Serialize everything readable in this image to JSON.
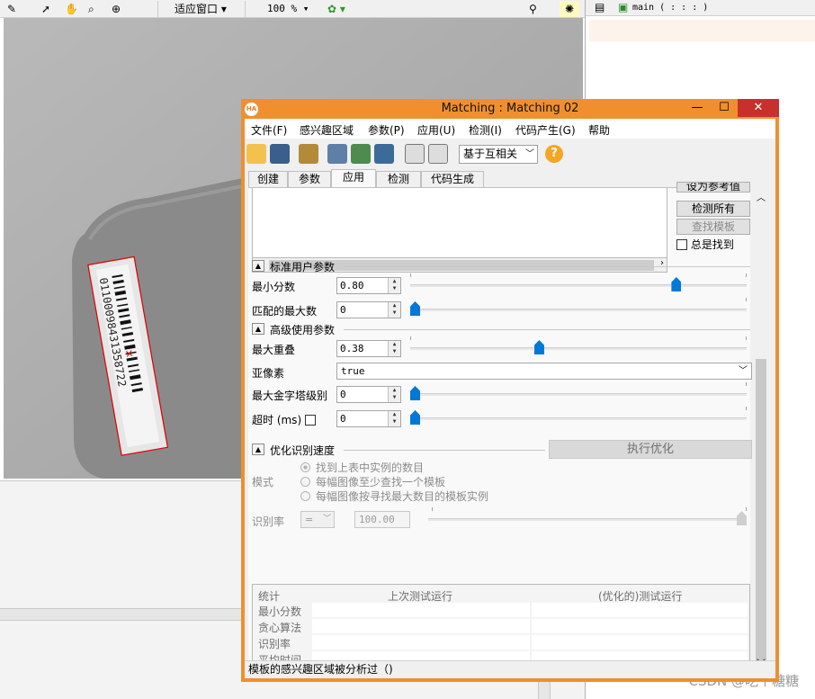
{
  "background_app": {
    "zoom_fit": "适应窗口",
    "zoom_percent": "100 %",
    "editor_tab": "main ( : : : )",
    "barcode_text": "01100098431358722"
  },
  "window": {
    "title": "Matching : Matching 02",
    "app_icon_text": "HA",
    "minimize": "—",
    "maximize": "☐",
    "close": "✕"
  },
  "menu": [
    "文件(F)",
    "感兴趣区域",
    "参数(P)",
    "应用(U)",
    "检测(I)",
    "代码产生(G)",
    "帮助"
  ],
  "toolbar": {
    "metric_combo": "基于互相关",
    "help_glyph": "?"
  },
  "tabs": [
    {
      "label": "创建",
      "active": false
    },
    {
      "label": "参数",
      "active": false
    },
    {
      "label": "应用",
      "active": true
    },
    {
      "label": "检测",
      "active": false
    },
    {
      "label": "代码生成",
      "active": false
    }
  ],
  "reference_panel": {
    "set_reference_btn": "设为参考值",
    "detect_all_btn": "检测所有",
    "find_model_btn": "查找模板",
    "always_find_label": "总是找到"
  },
  "standard_params": {
    "section_title": "标准用户参数",
    "min_score_label": "最小分数",
    "min_score_value": "0.80",
    "min_score_level": 0.8,
    "num_matches_label": "匹配的最大数",
    "num_matches_value": "0",
    "num_matches_level": 0.0
  },
  "advanced_params": {
    "section_title": "高级使用参数",
    "max_overlap_label": "最大重叠",
    "max_overlap_value": "0.38",
    "max_overlap_level": 0.38,
    "subpixel_label": "亚像素",
    "subpixel_value": "true",
    "pyramid_label": "最大金字塔级别",
    "pyramid_value": "0",
    "pyramid_level": 0.0,
    "timeout_label": "超时 (ms)",
    "timeout_value": "0",
    "timeout_level": 0.0
  },
  "optimize": {
    "section_title": "优化识别速度",
    "run_button": "执行优化",
    "mode_label": "模式",
    "modes": [
      {
        "label": "找到上表中实例的数目",
        "selected": true
      },
      {
        "label": "每幅图像至少查找一个模板",
        "selected": false
      },
      {
        "label": "每幅图像按寻找最大数目的模板实例",
        "selected": false
      }
    ],
    "rate_label": "识别率",
    "rate_operator": "=",
    "rate_value": "100.00",
    "rate_level": 1.0
  },
  "statistics": {
    "header_label": "统计",
    "col_last": "上次测试运行",
    "col_optimized": "(优化的)测试运行",
    "rows": [
      "最小分数",
      "贪心算法",
      "识别率",
      "平均时间"
    ]
  },
  "status_bar": "模板的感兴趣区域被分析过（)",
  "watermark": "CSDN @吃个糖糖",
  "colors": {
    "title_bar": "#f08f2e",
    "close_button": "#c8302b",
    "slider_thumb": "#0078d7",
    "help_icon": "#f5a623"
  }
}
